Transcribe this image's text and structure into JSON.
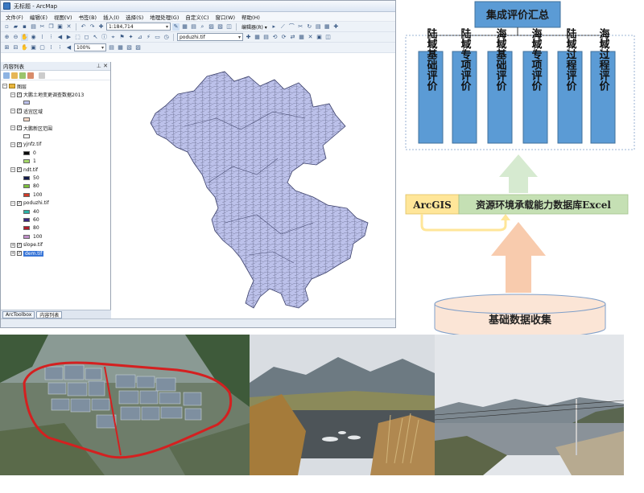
{
  "arcmap": {
    "window_title": "无标题 - ArcMap",
    "menu": [
      "文件(F)",
      "编辑(E)",
      "视图(V)",
      "书签(B)",
      "插入(I)",
      "选择(S)",
      "地理处理(G)",
      "自定义(C)",
      "窗口(W)",
      "帮助(H)"
    ],
    "scale": "1:184,714",
    "editor_label": "编辑器(R) ▾",
    "layer_combo": "poduzhi.tif",
    "zoom_combo": "100%",
    "toc": {
      "title": "内容列表",
      "root": "图层",
      "layers": [
        {
          "name": "大鹏土地变更调查数据2013",
          "swatch": "#bcc1ea"
        },
        {
          "name": "适宜区域",
          "swatch": "#f3d6c4"
        },
        {
          "name": "大鹏新区范围",
          "swatch": "#ffffff"
        },
        {
          "name": "yjnfz.tif",
          "classes": [
            {
              "label": "0",
              "color": "#0a0a0a"
            },
            {
              "label": "1",
              "color": "#a6d96a"
            }
          ]
        },
        {
          "name": "ndt.tif",
          "classes": [
            {
              "label": "50",
              "color": "#121a4a"
            },
            {
              "label": "80",
              "color": "#7bbf3c"
            },
            {
              "label": "100",
              "color": "#d03b2a"
            }
          ]
        },
        {
          "name": "poduzhi.tif",
          "classes": [
            {
              "label": "40",
              "color": "#2bb1a6"
            },
            {
              "label": "60",
              "color": "#3a2680"
            },
            {
              "label": "80",
              "color": "#b11a2a"
            },
            {
              "label": "100",
              "color": "#c08fc8"
            }
          ]
        },
        {
          "name": "slope.tif"
        },
        {
          "name": "dem.tif",
          "selected": true
        }
      ],
      "tabs": [
        "ArcToolbox",
        "内容列表"
      ]
    }
  },
  "diagram": {
    "top_box": "集成评价汇总",
    "evals": [
      "陆域基础评价",
      "陆域专项评价",
      "海域基础评价",
      "海域专项评价",
      "陆域过程评价",
      "海域过程评价"
    ],
    "arcgis": "ArcGIS",
    "database": "资源环境承载能力数据库Excel",
    "base": "基础数据收集",
    "colors": {
      "eval_box": "#5b9bd5",
      "top_box": "#5b9bd5",
      "arcgis_box": "#ffe699",
      "db_box": "#c5e0b4",
      "arrow_green": "#d6ead0",
      "arrow_orange": "#f8cbad",
      "base_cylinder": "#fbe5d6"
    }
  }
}
